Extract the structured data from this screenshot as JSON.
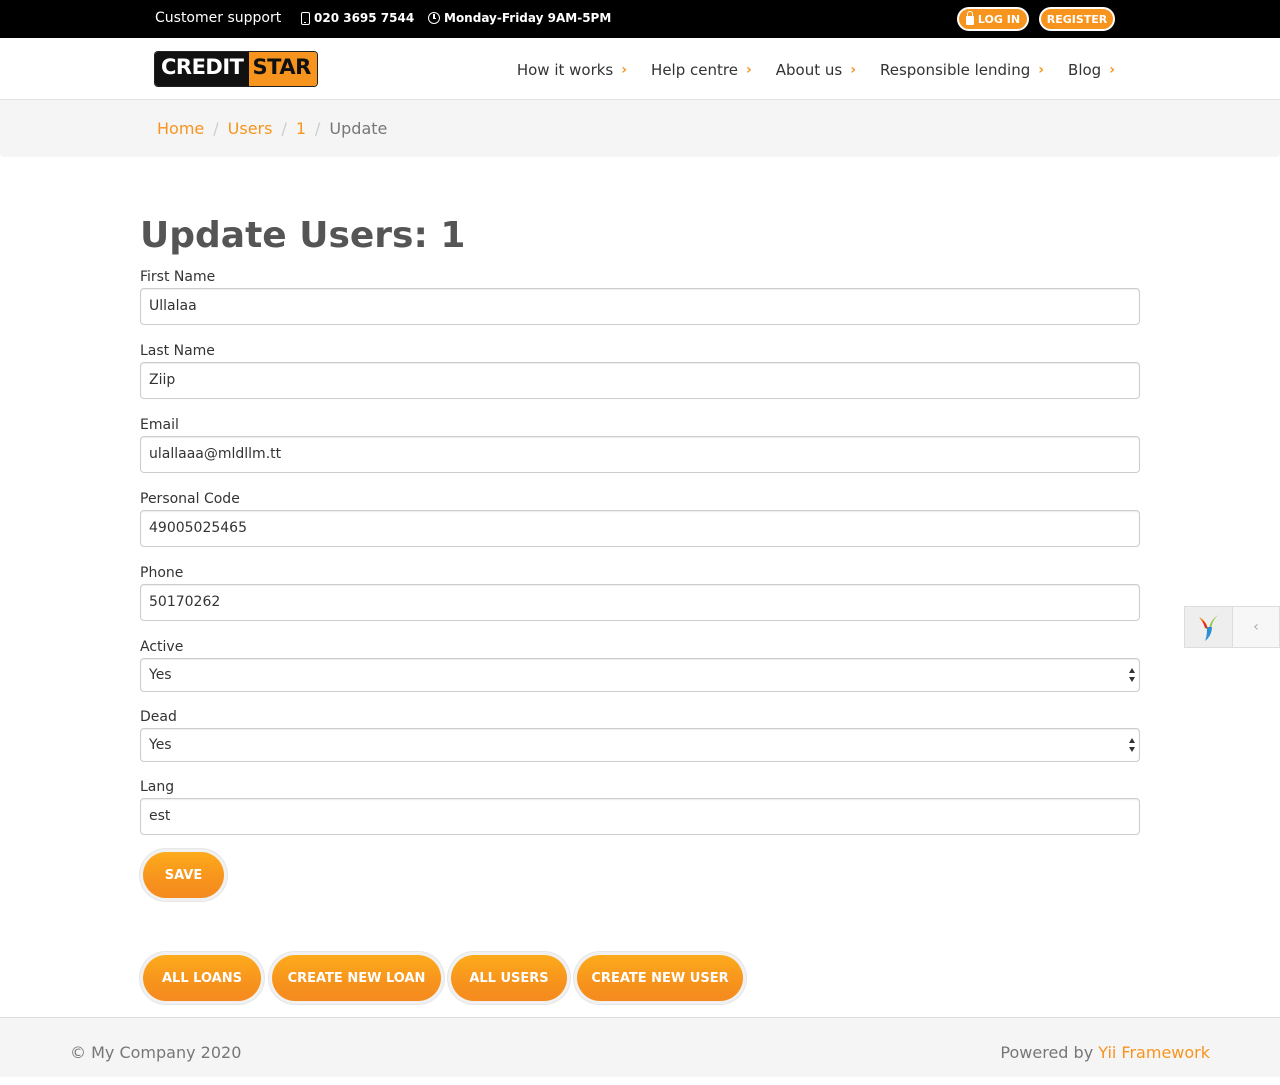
{
  "topbar": {
    "support": "Customer support",
    "phone": "020 3695 7544",
    "hours": "Monday-Friday 9AM-5PM",
    "login": "LOG IN",
    "register": "REGISTER"
  },
  "brand": {
    "part1": "CREDIT",
    "part2": "STAR"
  },
  "nav": {
    "items": [
      {
        "label": "How it works"
      },
      {
        "label": "Help centre"
      },
      {
        "label": "About us"
      },
      {
        "label": "Responsible lending"
      },
      {
        "label": "Blog"
      }
    ],
    "chevron": "›"
  },
  "breadcrumb": {
    "items": [
      "Home",
      "Users",
      "1"
    ],
    "active": "Update",
    "separator": "/"
  },
  "page": {
    "title": "Update Users: 1"
  },
  "form": {
    "first_name": {
      "label": "First Name",
      "value": "Ullalaa"
    },
    "last_name": {
      "label": "Last Name",
      "value": "Ziip"
    },
    "email": {
      "label": "Email",
      "value": "ulallaaa@mldllm.tt"
    },
    "personal_code": {
      "label": "Personal Code",
      "value": "49005025465"
    },
    "phone": {
      "label": "Phone",
      "value": "50170262"
    },
    "active": {
      "label": "Active",
      "value": "Yes"
    },
    "dead": {
      "label": "Dead",
      "value": "Yes"
    },
    "lang": {
      "label": "Lang",
      "value": "est"
    },
    "save": "SAVE"
  },
  "actions": {
    "all_loans": "ALL LOANS",
    "create_loan": "CREATE NEW LOAN",
    "all_users": "ALL USERS",
    "create_user": "CREATE NEW USER"
  },
  "footer": {
    "copyright": "© My Company 2020",
    "powered_prefix": "Powered by",
    "powered_link": "Yii Framework"
  },
  "colors": {
    "accent": "#f7941d",
    "topbar": "#000000",
    "breadcrumb_bg": "#f5f5f5"
  }
}
